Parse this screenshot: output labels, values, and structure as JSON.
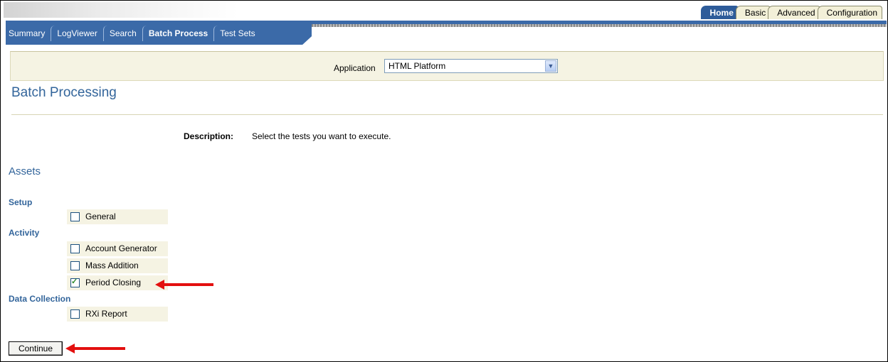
{
  "global_tabs": [
    {
      "label": "Home",
      "active": true
    },
    {
      "label": "Basic",
      "active": false
    },
    {
      "label": "Advanced",
      "active": false
    },
    {
      "label": "Configuration",
      "active": false
    }
  ],
  "nav_tabs": [
    {
      "label": "Summary",
      "active": false
    },
    {
      "label": "LogViewer",
      "active": false
    },
    {
      "label": "Search",
      "active": false
    },
    {
      "label": "Batch Process",
      "active": true
    },
    {
      "label": "Test Sets",
      "active": false
    }
  ],
  "application": {
    "label": "Application",
    "selected": "HTML Platform"
  },
  "page": {
    "title": "Batch Processing"
  },
  "description": {
    "label": "Description:",
    "text": "Select the tests you want to execute."
  },
  "assets": {
    "heading": "Assets"
  },
  "groups": [
    {
      "label": "Setup",
      "items": [
        {
          "label": "General",
          "checked": false
        }
      ]
    },
    {
      "label": "Activity",
      "items": [
        {
          "label": "Account Generator",
          "checked": false
        },
        {
          "label": "Mass Addition",
          "checked": false
        },
        {
          "label": "Period Closing",
          "checked": true
        }
      ]
    },
    {
      "label": "Data Collection",
      "items": [
        {
          "label": "RXi Report",
          "checked": false
        }
      ]
    }
  ],
  "actions": {
    "continue_label": "Continue"
  },
  "colors": {
    "nav_blue": "#3b6aa8",
    "heading_blue": "#33659b",
    "band": "#f5f3e3",
    "arrow_red": "#e3100f"
  }
}
